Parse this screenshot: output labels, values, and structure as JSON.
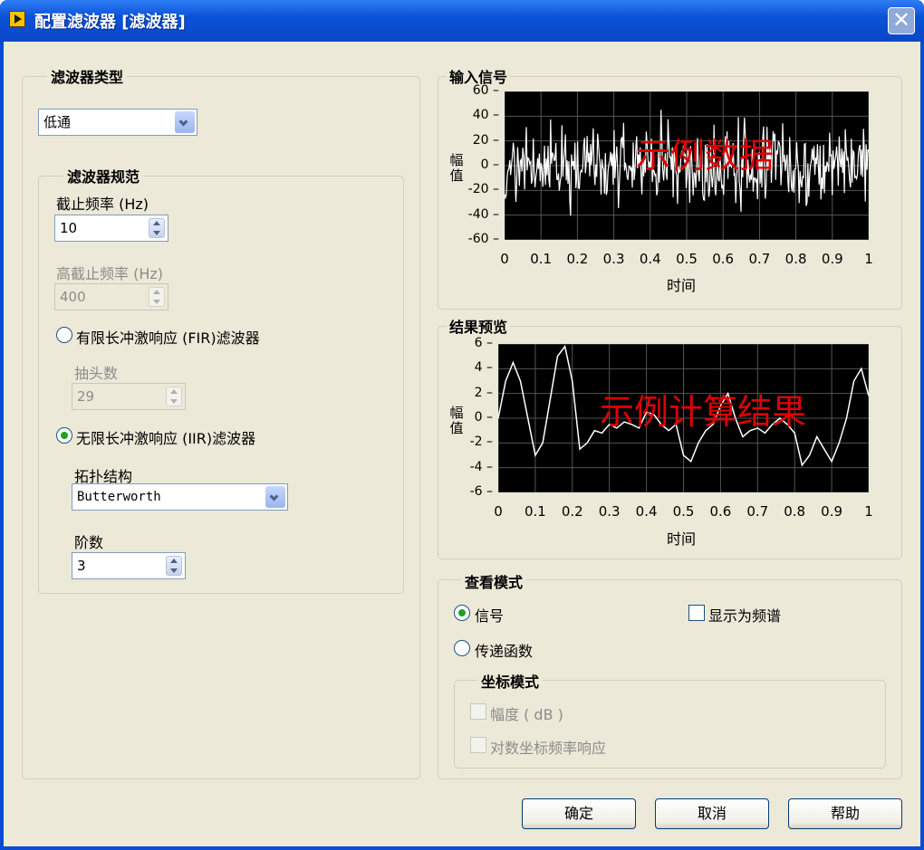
{
  "window": {
    "title": "配置滤波器 [滤波器]"
  },
  "filter_type": {
    "group_label": "滤波器类型",
    "selected": "低通"
  },
  "spec": {
    "group_label": "滤波器规范",
    "cutoff_label": "截止频率 (Hz)",
    "cutoff_value": "10",
    "high_cutoff_label": "高截止频率 (Hz)",
    "high_cutoff_value": "400",
    "fir_label": "有限长冲激响应 (FIR)滤波器",
    "taps_label": "抽头数",
    "taps_value": "29",
    "iir_label": "无限长冲激响应 (IIR)滤波器",
    "topology_label": "拓扑结构",
    "topology_value": "Butterworth",
    "order_label": "阶数",
    "order_value": "3",
    "selected_filter": "iir"
  },
  "input_graph": {
    "title": "输入信号",
    "ylabel": "幅值",
    "xlabel": "时间",
    "watermark": "示例数据",
    "yticks": [
      "60",
      "40",
      "20",
      "0",
      "-20",
      "-40",
      "-60"
    ],
    "xticks": [
      "0",
      "0.1",
      "0.2",
      "0.3",
      "0.4",
      "0.5",
      "0.6",
      "0.7",
      "0.8",
      "0.9",
      "1"
    ]
  },
  "result_graph": {
    "title": "结果预览",
    "ylabel": "幅值",
    "xlabel": "时间",
    "watermark": "示例计算结果",
    "yticks": [
      "6",
      "4",
      "2",
      "0",
      "-2",
      "-4",
      "-6"
    ],
    "xticks": [
      "0",
      "0.1",
      "0.2",
      "0.3",
      "0.4",
      "0.5",
      "0.6",
      "0.7",
      "0.8",
      "0.9",
      "1"
    ]
  },
  "view_mode": {
    "group_label": "查看模式",
    "signal_label": "信号",
    "transfer_label": "传递函数",
    "spectrum_label": "显示为频谱",
    "selected": "signal",
    "spectrum_checked": false
  },
  "axis_mode": {
    "group_label": "坐标模式",
    "magnitude_db_label": "幅度 ( dB )",
    "log_freq_label": "对数坐标频率响应"
  },
  "buttons": {
    "ok": "确定",
    "cancel": "取消",
    "help": "帮助"
  },
  "chart_data": [
    {
      "type": "line",
      "title": "输入信号",
      "xlabel": "时间",
      "ylabel": "幅值",
      "xlim": [
        0,
        1
      ],
      "ylim": [
        -60,
        60
      ],
      "grid": true,
      "series": [
        {
          "x": [
            0,
            0.02,
            0.04,
            0.06,
            0.08,
            0.1,
            0.12,
            0.14,
            0.16,
            0.18,
            0.2,
            0.22,
            0.24,
            0.26,
            0.28,
            0.3,
            0.32,
            0.34,
            0.36,
            0.38,
            0.4,
            0.42,
            0.44,
            0.46,
            0.48,
            0.5,
            0.52,
            0.54,
            0.56,
            0.58,
            0.6,
            0.62,
            0.64,
            0.66,
            0.68,
            0.7,
            0.72,
            0.74,
            0.76,
            0.78,
            0.8,
            0.82,
            0.84,
            0.86,
            0.88,
            0.9,
            0.92,
            0.94,
            0.96,
            0.98,
            1
          ],
          "y": [
            5,
            30,
            -20,
            25,
            -45,
            10,
            35,
            -30,
            20,
            -15,
            40,
            -25,
            15,
            -40,
            30,
            -10,
            20,
            -35,
            25,
            5,
            -20,
            40,
            -30,
            15,
            -10,
            35,
            -45,
            20,
            -25,
            10,
            30,
            -15,
            25,
            -40,
            15,
            -5,
            35,
            -30,
            20,
            -20,
            10,
            40,
            -25,
            15,
            -35,
            25,
            -10,
            30,
            -20,
            20,
            0
          ]
        }
      ]
    },
    {
      "type": "line",
      "title": "结果预览",
      "xlabel": "时间",
      "ylabel": "幅值",
      "xlim": [
        0,
        1
      ],
      "ylim": [
        -6,
        6
      ],
      "grid": true,
      "series": [
        {
          "x": [
            0,
            0.02,
            0.04,
            0.06,
            0.08,
            0.1,
            0.12,
            0.14,
            0.16,
            0.18,
            0.2,
            0.22,
            0.24,
            0.26,
            0.28,
            0.3,
            0.32,
            0.34,
            0.36,
            0.38,
            0.4,
            0.42,
            0.44,
            0.46,
            0.48,
            0.5,
            0.52,
            0.54,
            0.56,
            0.58,
            0.6,
            0.62,
            0.64,
            0.66,
            0.68,
            0.7,
            0.72,
            0.74,
            0.76,
            0.78,
            0.8,
            0.82,
            0.84,
            0.86,
            0.88,
            0.9,
            0.92,
            0.94,
            0.96,
            0.98,
            1
          ],
          "y": [
            0,
            3,
            4.5,
            3,
            0,
            -3,
            -2,
            1.5,
            5,
            5.8,
            3,
            -2.5,
            -2,
            -1,
            -1.2,
            -0.5,
            -0.8,
            -0.3,
            -0.5,
            -0.8,
            0.5,
            0.3,
            -0.5,
            -1,
            -0.5,
            -3,
            -3.5,
            -2,
            -1,
            -0.5,
            1,
            2,
            0,
            -1.5,
            -1,
            -0.8,
            -1.2,
            -0.5,
            0,
            -0.5,
            -1.2,
            -3.8,
            -3,
            -1.5,
            -2.5,
            -3.5,
            -2,
            0,
            3,
            4,
            1.8
          ]
        }
      ]
    }
  ]
}
